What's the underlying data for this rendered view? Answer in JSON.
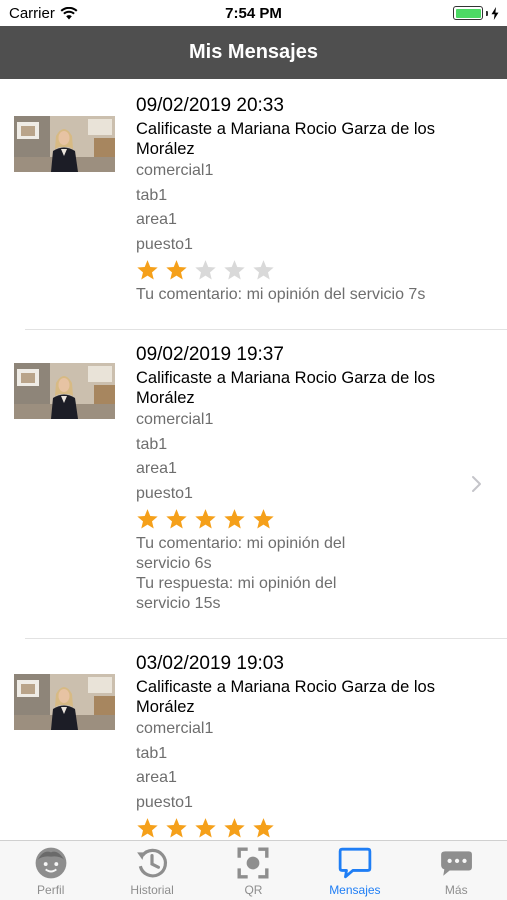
{
  "status_bar": {
    "carrier": "Carrier",
    "time": "7:54 PM",
    "battery_level": 1.0
  },
  "nav": {
    "title": "Mis Mensajes"
  },
  "messages": [
    {
      "date": "09/02/2019 20:33",
      "title": "Calificaste a Mariana Rocio Garza de los Morález",
      "meta": [
        "comercial1",
        "tab1",
        "area1",
        "puesto1"
      ],
      "rating": 2,
      "comment": "Tu comentario: mi opinión del servicio 7s",
      "reply": ""
    },
    {
      "date": "09/02/2019 19:37",
      "title": "Calificaste a Mariana Rocio Garza de los Morález",
      "meta": [
        "comercial1",
        "tab1",
        "area1",
        "puesto1"
      ],
      "rating": 5,
      "comment": "Tu comentario: mi opinión del servicio 6s",
      "reply": "Tu respuesta: mi opinión del servicio 15s"
    },
    {
      "date": "03/02/2019 19:03",
      "title": "Calificaste a Mariana Rocio Garza de los Morález",
      "meta": [
        "comercial1",
        "tab1",
        "area1",
        "puesto1"
      ],
      "rating": 5,
      "comment": "",
      "reply": ""
    }
  ],
  "tabs": [
    {
      "label": "Perfil",
      "icon": "face-icon",
      "active": false
    },
    {
      "label": "Historial",
      "icon": "history-icon",
      "active": false
    },
    {
      "label": "QR",
      "icon": "qr-scan-icon",
      "active": false
    },
    {
      "label": "Mensajes",
      "icon": "chat-bubble-icon",
      "active": true
    },
    {
      "label": "Más",
      "icon": "more-icon",
      "active": false
    }
  ],
  "colors": {
    "nav_background": "#4f4f4f",
    "star_filled": "#f5a01a",
    "star_empty": "#d9d9d9",
    "tab_active": "#1f7ef5",
    "tab_inactive": "#8e8e8e"
  }
}
